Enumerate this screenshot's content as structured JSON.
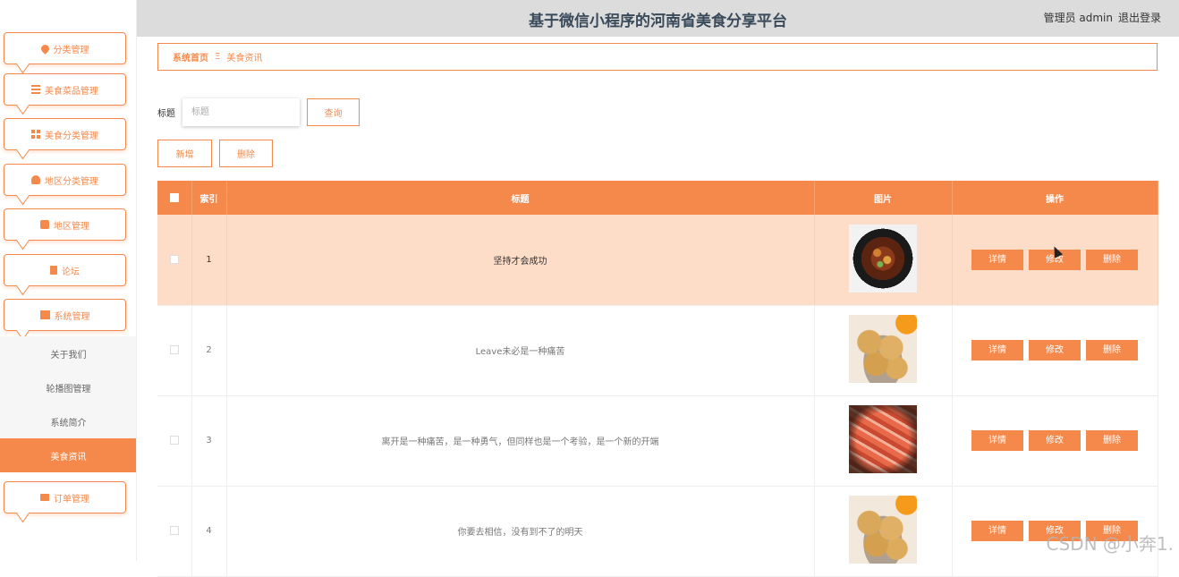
{
  "header": {
    "title": "基于微信小程序的河南省美食分享平台",
    "admin_label": "管理员 admin",
    "logout_label": "退出登录"
  },
  "sidebar": {
    "menus": [
      {
        "label": "分类管理",
        "icon": "heart-icon"
      },
      {
        "label": "美食菜品管理",
        "icon": "list-icon"
      },
      {
        "label": "美食分类管理",
        "icon": "grid-icon"
      },
      {
        "label": "地区分类管理",
        "icon": "user-icon"
      },
      {
        "label": "地区管理",
        "icon": "briefcase-icon"
      },
      {
        "label": "论坛",
        "icon": "clipboard-icon"
      },
      {
        "label": "系统管理",
        "icon": "book-icon"
      },
      {
        "label": "订单管理",
        "icon": "monitor-icon"
      }
    ],
    "sub_items": [
      "关于我们",
      "轮播图管理",
      "系统简介",
      "美食资讯"
    ],
    "active_sub": "美食资讯"
  },
  "breadcrumb": {
    "home": "系统首页",
    "separator": "Ξ",
    "current": "美食资讯"
  },
  "search": {
    "label": "标题",
    "placeholder": "标题",
    "value": "",
    "query_button": "查询"
  },
  "toolbar": {
    "add_button": "新增",
    "delete_button": "删除"
  },
  "table": {
    "columns": [
      "索引",
      "标题",
      "图片",
      "操作"
    ],
    "rows": [
      {
        "index": "1",
        "title": "坚持才会成功",
        "image": "braised-meat-dish"
      },
      {
        "index": "2",
        "title": "Leave未必是一种痛苦",
        "image": "fried-meatballs"
      },
      {
        "index": "3",
        "title": "离开是一种痛苦，是一种勇气，但同样也是一个考验，是一个新的开端",
        "image": "shrimp-dish"
      },
      {
        "index": "4",
        "title": "你要去相信，没有到不了的明天",
        "image": "fried-meatballs"
      }
    ],
    "actions": [
      "详情",
      "修改",
      "删除"
    ],
    "highlighted_row": 1
  },
  "watermark": "CSDN @小奔1.",
  "colors": {
    "accent": "#f5894b",
    "row_highlight": "#fddcc8",
    "header_bg": "#dcdcdc"
  }
}
